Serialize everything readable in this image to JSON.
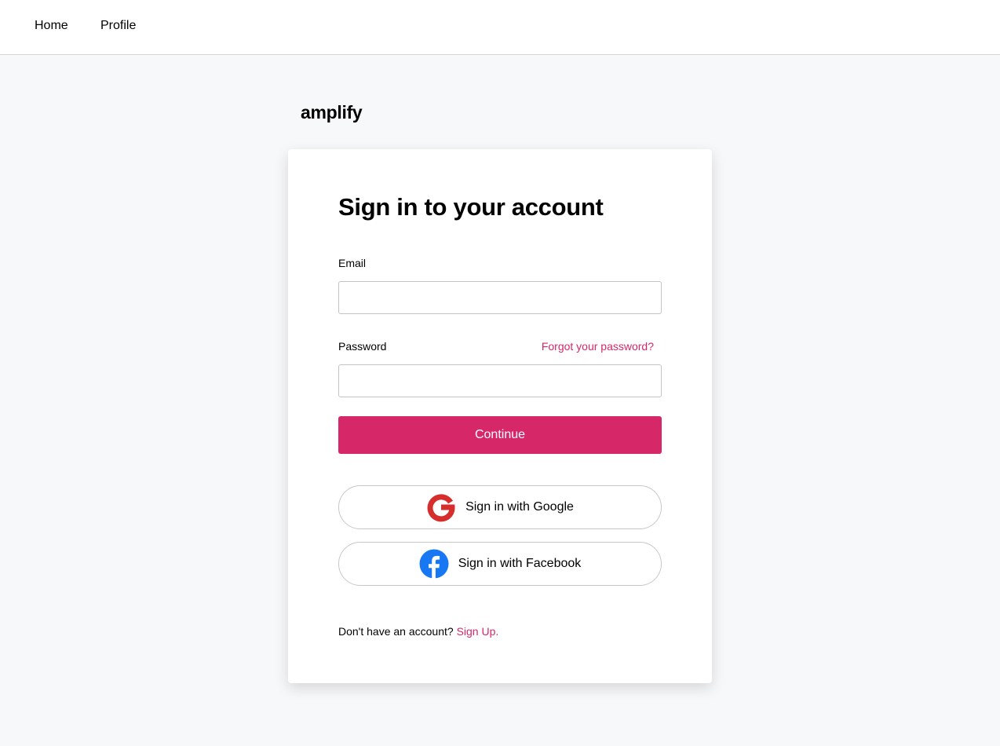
{
  "nav": {
    "home": "Home",
    "profile": "Profile"
  },
  "brand": "amplify",
  "signin": {
    "title": "Sign in to your account",
    "email_label": "Email",
    "email_value": "",
    "password_label": "Password",
    "password_value": "",
    "forgot_link": "Forgot your password?",
    "continue_label": "Continue",
    "google_label": "Sign in with Google",
    "google_icon": "google-g-icon",
    "facebook_label": "Sign in with Facebook",
    "facebook_icon": "facebook-icon",
    "no_account_text": "Don't have an account?",
    "signup_link": "Sign Up."
  },
  "colors": {
    "accent": "#d62769",
    "google_red": "#d62d2d",
    "facebook_blue": "#1877f2",
    "page_background": "#f7f8fa"
  }
}
